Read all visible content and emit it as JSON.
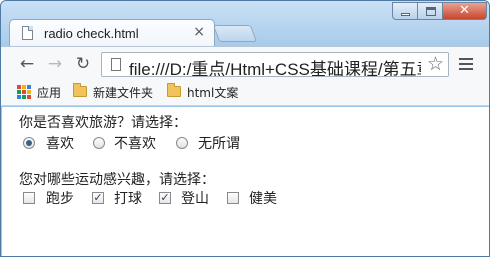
{
  "browser": {
    "tab_title": "radio check.html",
    "url": "file:///D:/重点/Html+CSS基础课程/第五章",
    "bookmarks": [
      {
        "label": "应用",
        "icon": "apps-grid-icon"
      },
      {
        "label": "新建文件夹",
        "icon": "folder-icon"
      },
      {
        "label": "html文案",
        "icon": "folder-icon"
      }
    ]
  },
  "page": {
    "question1": "你是否喜欢旅游？请选择：",
    "radios": [
      {
        "label": "喜欢",
        "checked": true
      },
      {
        "label": "不喜欢",
        "checked": false
      },
      {
        "label": "无所谓",
        "checked": false
      }
    ],
    "question2": "您对哪些运动感兴趣，请选择：",
    "checkboxes": [
      {
        "label": "跑步",
        "checked": false
      },
      {
        "label": "打球",
        "checked": true
      },
      {
        "label": "登山",
        "checked": true
      },
      {
        "label": "健美",
        "checked": false
      }
    ]
  },
  "colors": {
    "titlebar": "#a8cbeb",
    "close_button": "#c8452e"
  }
}
